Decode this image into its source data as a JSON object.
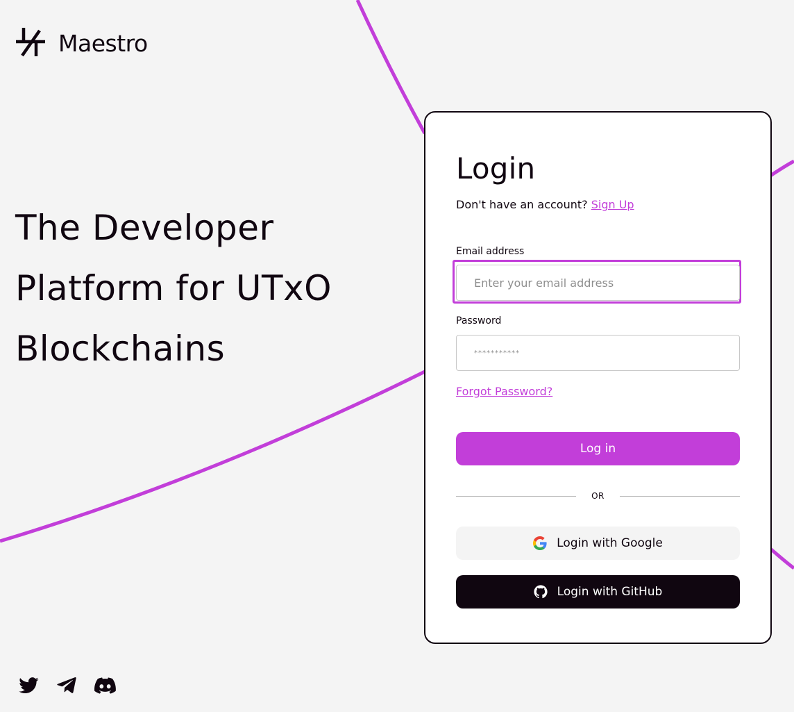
{
  "brand": {
    "name": "Maestro",
    "accent_color": "#c23ed9",
    "dark_color": "#100610",
    "logo_icon": "maestro-logo-icon"
  },
  "hero": {
    "lines": [
      "The Developer",
      "Platform for UTxO",
      "Blockchains"
    ]
  },
  "login": {
    "title": "Login",
    "no_account_text": "Don't have an account?",
    "signup_link": "Sign Up",
    "email_label": "Email address",
    "email_placeholder": "Enter your email address",
    "email_value": "",
    "password_label": "Password",
    "password_placeholder": "***********",
    "password_value": "",
    "forgot_password_link": "Forgot Password?",
    "login_button": "Log in",
    "divider_text": "OR",
    "google_button": "Login with Google",
    "github_button": "Login with GitHub"
  },
  "socials": [
    {
      "name": "Twitter",
      "icon": "twitter-icon"
    },
    {
      "name": "Telegram",
      "icon": "telegram-icon"
    },
    {
      "name": "Discord",
      "icon": "discord-icon"
    }
  ]
}
